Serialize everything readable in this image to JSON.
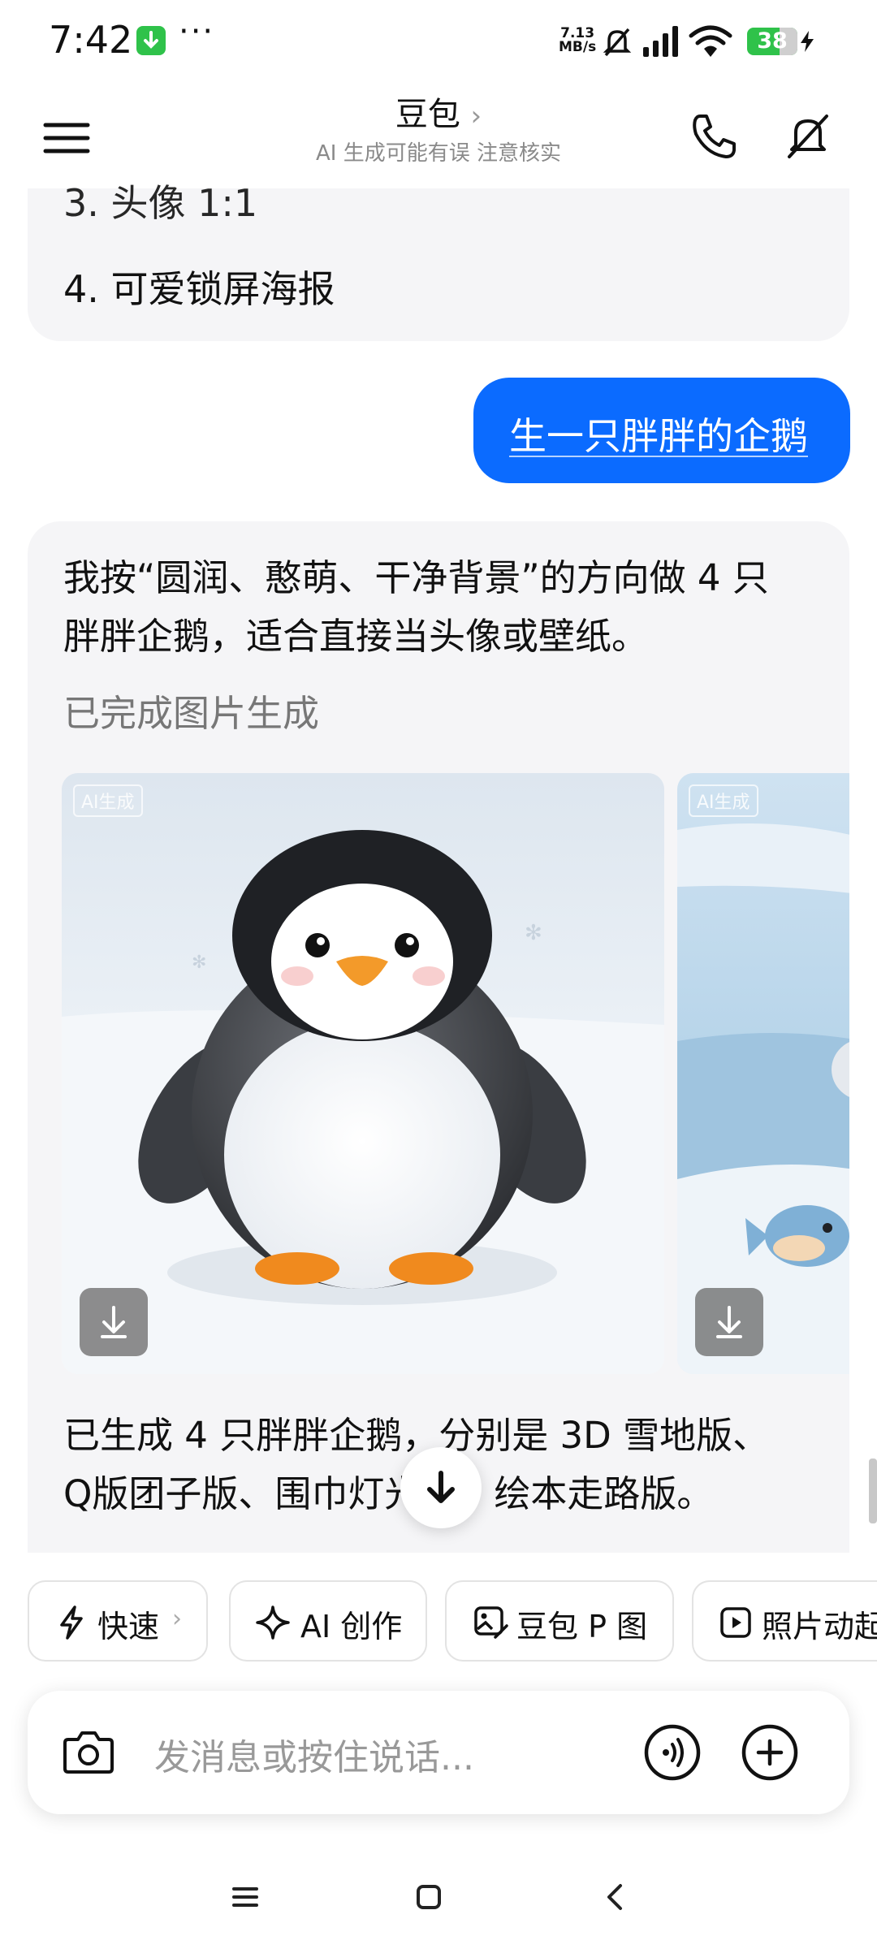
{
  "status_bar": {
    "time": "7:42",
    "more": "···",
    "net_speed_value": "7.13",
    "net_speed_unit": "MB/s",
    "battery": "38"
  },
  "header": {
    "title": "豆包",
    "title_chevron": "›",
    "subtitle": "AI 生成可能有误 注意核实"
  },
  "chat": {
    "list_items": [
      "3. 头像 1:1",
      "4. 可爱锁屏海报"
    ],
    "user_message": "生一只胖胖的企鹅",
    "ai_reply_line1": "我按“圆润、憨萌、干净背景”的方向做 4 只",
    "ai_reply_line2": "胖胖企鹅，适合直接当头像或壁纸。",
    "generation_status": "已完成图片生成",
    "image_tag": "AI生成",
    "summary_line1": "已生成 4 只胖胖企鹅，分别是 3D 雪地版、",
    "summary_line2": "Q版团子版、围巾灯光版、绘本走路版。"
  },
  "chips": [
    {
      "label": "快速",
      "icon": "lightning-icon",
      "chevron": "›"
    },
    {
      "label": "AI 创作",
      "icon": "sparkle-icon"
    },
    {
      "label": "豆包 P 图",
      "icon": "image-edit-icon"
    },
    {
      "label": "照片动起来",
      "icon": "play-icon"
    }
  ],
  "input": {
    "placeholder": "发消息或按住说话..."
  },
  "colors": {
    "accent": "#0b6bff",
    "bubble_bg": "#f5f5f7",
    "battery_green": "#2fc24a"
  }
}
